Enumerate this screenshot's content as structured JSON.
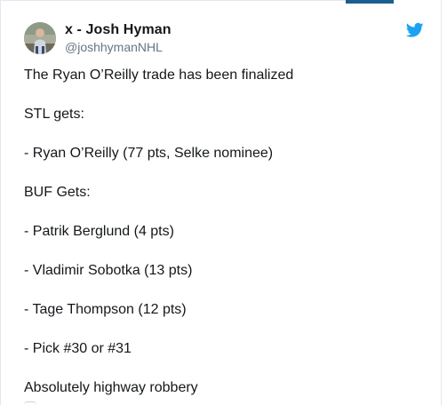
{
  "tweet": {
    "display_name": "x - Josh Hyman",
    "handle": "@joshhymanNHL",
    "lines": [
      "The Ryan O’Reilly trade has been finalized",
      "STL gets:",
      "- Ryan O’Reilly (77 pts, Selke nominee)",
      "BUF Gets:",
      "- Patrik Berglund (4 pts)",
      "- Vladimir Sobotka (13 pts)",
      "- Tage Thompson (12 pts)",
      "- Pick #30 or #31",
      "Absolutely highway robbery"
    ]
  },
  "icons": {
    "brand": "twitter-bird-icon",
    "avatar": "user-avatar"
  },
  "colors": {
    "brand_blue": "#1da1f2",
    "text": "#14171a",
    "secondary_text": "#657786",
    "top_accent": "#1b5e8f"
  }
}
